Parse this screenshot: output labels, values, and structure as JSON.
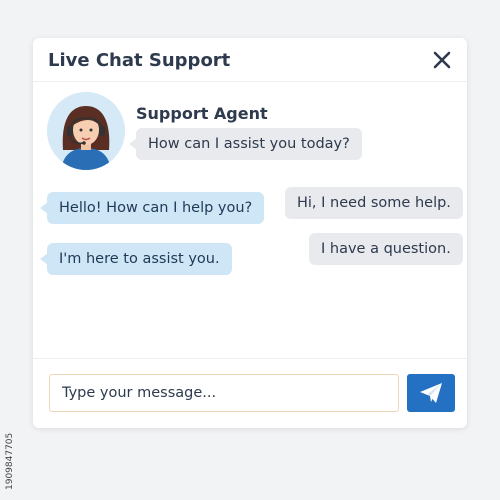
{
  "window": {
    "title": "Live Chat Support",
    "close_icon": "close-icon"
  },
  "agent": {
    "name": "Support Agent",
    "greeting": "How can I assist you today?",
    "avatar_icon": "agent-avatar-headset"
  },
  "messages": [
    {
      "from": "agent",
      "text": "Hello! How can I help you?"
    },
    {
      "from": "user",
      "text": "Hi, I need some help."
    },
    {
      "from": "agent",
      "text": "I'm here to assist you."
    },
    {
      "from": "user",
      "text": "I have a question."
    }
  ],
  "composer": {
    "placeholder": "Type your message...",
    "send_icon": "send-icon"
  },
  "watermark_id": "1909847705",
  "colors": {
    "accent": "#2470c2",
    "agent_bubble": "#cfe6f6",
    "user_bubble": "#e8eaee",
    "title_text": "#2e3a4d"
  }
}
